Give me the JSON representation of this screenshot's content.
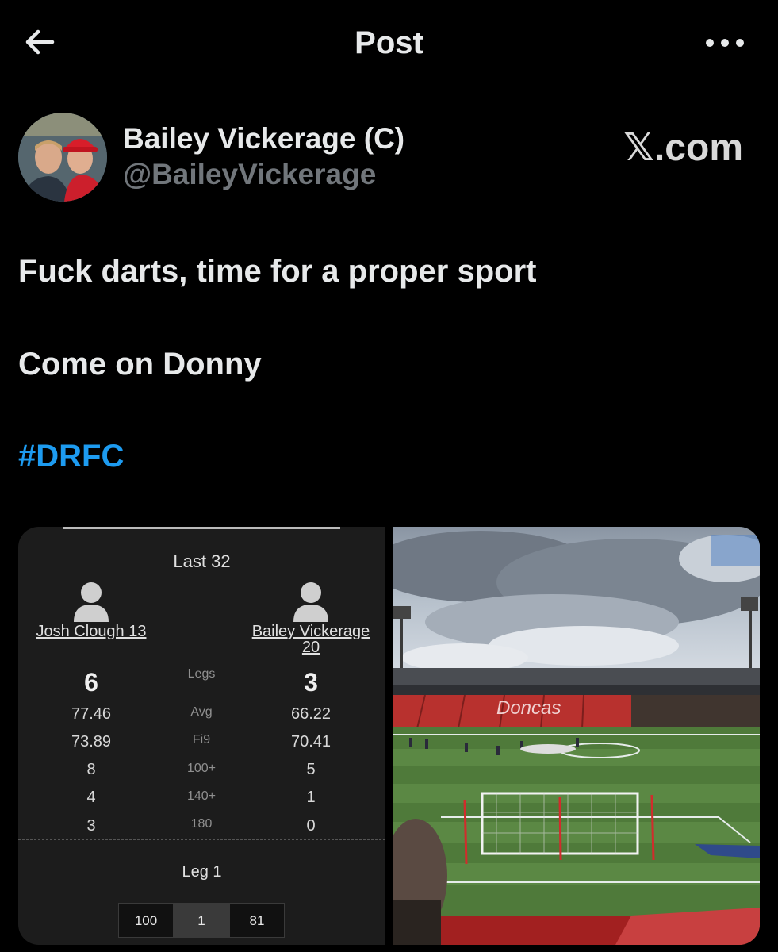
{
  "header": {
    "title": "Post",
    "back_icon": "arrow-left-icon",
    "more_icon": "more-horizontal-icon"
  },
  "post": {
    "author_name": "Bailey Vickerage (C)",
    "author_handle": "@BaileyVickerage",
    "watermark": "𝕏.com",
    "lines": [
      "Fuck darts, time for a proper sport",
      "Come on Donny"
    ],
    "hashtag": "#DRFC"
  },
  "darts": {
    "round": "Last 32",
    "player1": "Josh Clough 13",
    "player2_line1": "Bailey Vickerage",
    "player2_line2": "20",
    "stats": [
      {
        "label": "Legs",
        "p1": "6",
        "p2": "3"
      },
      {
        "label": "Avg",
        "p1": "77.46",
        "p2": "66.22"
      },
      {
        "label": "Fi9",
        "p1": "73.89",
        "p2": "70.41"
      },
      {
        "label": "100+",
        "p1": "8",
        "p2": "5"
      },
      {
        "label": "140+",
        "p1": "4",
        "p2": "1"
      },
      {
        "label": "180",
        "p1": "3",
        "p2": "0"
      }
    ],
    "leg_title": "Leg 1",
    "leg_scores": [
      "100",
      "1",
      "81"
    ]
  },
  "stadium": {
    "stand_text": "Doncas"
  },
  "colors": {
    "background": "#000000",
    "text": "#e7e9ea",
    "secondary": "#71767b",
    "link": "#1d9bf0"
  }
}
